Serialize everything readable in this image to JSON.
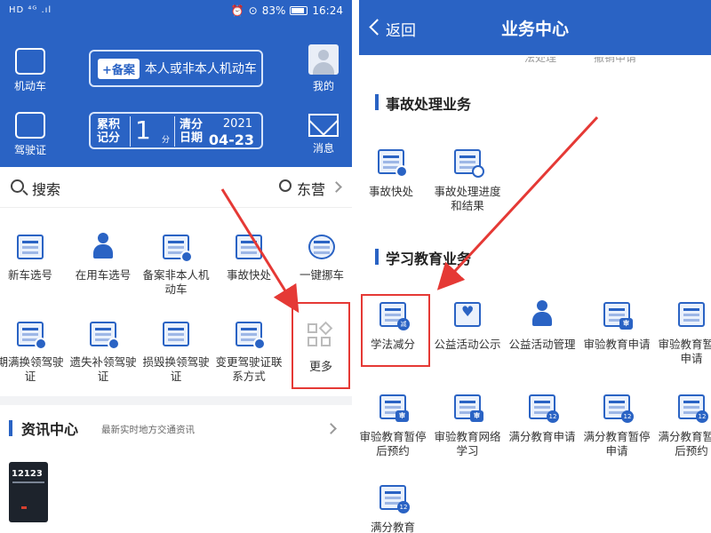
{
  "left": {
    "status_bar": {
      "left": "HD ⁴ᴳ .ıl",
      "battery": "83%",
      "time": "16:24"
    },
    "side_left": [
      {
        "label": "机动车"
      },
      {
        "label": "驾驶证"
      }
    ],
    "side_right": [
      {
        "label": "我的"
      },
      {
        "label": "消息"
      }
    ],
    "plate1": {
      "tag": "+备案",
      "text": "本人或非本人机动车"
    },
    "plate2": {
      "label1": "累积记分",
      "points": "1",
      "unit": "分",
      "label2": "清分日期",
      "year": "2021",
      "date": "04-23"
    },
    "search": {
      "label": "搜索",
      "location": "东营"
    },
    "grid": [
      {
        "label": "新车选号"
      },
      {
        "label": "在用车选号"
      },
      {
        "label": "备案非本人机动车"
      },
      {
        "label": "事故快处"
      },
      {
        "label": "一键挪车"
      },
      {
        "label": "期满换领驾驶证"
      },
      {
        "label": "遗失补领驾驶证"
      },
      {
        "label": "损毁换领驾驶证"
      },
      {
        "label": "变更驾驶证联系方式"
      },
      {
        "label": "更多"
      }
    ],
    "news": {
      "title": "资讯中心",
      "subtitle": "最新实时地方交通资讯",
      "thumb_text": "12123"
    }
  },
  "right": {
    "header": {
      "back": "返回",
      "title": "业务中心"
    },
    "peek": [
      "法处理",
      "撤销申请"
    ],
    "section1": {
      "title": "事故处理业务",
      "items": [
        {
          "label": "事故快处"
        },
        {
          "label": "事故处理进度和结果"
        }
      ]
    },
    "section2": {
      "title": "学习教育业务",
      "items": [
        {
          "label": "学法减分"
        },
        {
          "label": "公益活动公示"
        },
        {
          "label": "公益活动管理"
        },
        {
          "label": "审验教育申请"
        },
        {
          "label": "审验教育暂停申请"
        },
        {
          "label": "审验教育暂停后预约"
        },
        {
          "label": "审验教育网络学习"
        },
        {
          "label": "满分教育申请"
        },
        {
          "label": "满分教育暂停申请"
        },
        {
          "label": "满分教育暂停后预约"
        },
        {
          "label": "满分教育"
        }
      ],
      "badges": {
        "sq": "审",
        "num": "12",
        "xue": "减"
      }
    }
  },
  "colors": {
    "brand_blue": "#2a63c4",
    "highlight_red": "#e53935"
  }
}
